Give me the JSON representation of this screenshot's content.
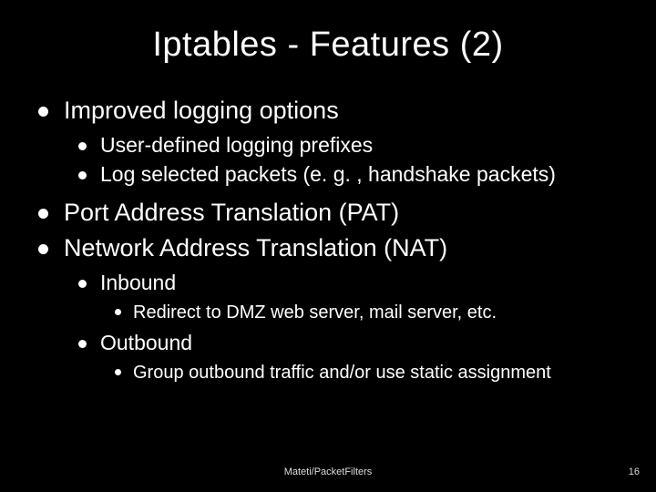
{
  "title": "Iptables - Features (2)",
  "bullets": {
    "b1": "Improved logging options",
    "b1a": "User-defined logging prefixes",
    "b1b": "Log selected packets (e. g. , handshake packets)",
    "b2": "Port Address Translation (PAT)",
    "b3": "Network Address Translation (NAT)",
    "b3a": "Inbound",
    "b3a1": "Redirect to DMZ web server, mail server, etc.",
    "b3b": "Outbound",
    "b3b1": "Group outbound traffic and/or use static assignment"
  },
  "footer": {
    "center": "Mateti/PacketFilters",
    "page": "16"
  }
}
